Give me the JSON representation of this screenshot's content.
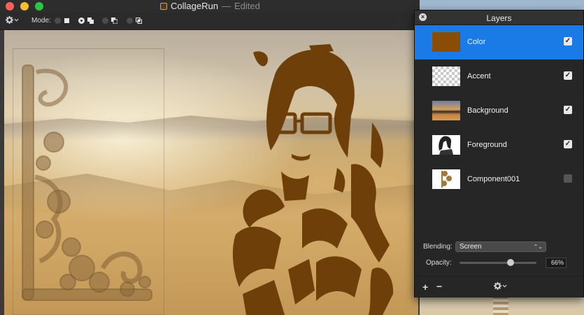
{
  "app": {
    "title": "CollageRun",
    "title_separator": "—",
    "status": "Edited"
  },
  "toolbar": {
    "gear_icon": "gear-icon",
    "mode_label": "Mode:",
    "modes": [
      {
        "icon": "mode-square-icon",
        "selected": false
      },
      {
        "icon": "mode-overlap-icon",
        "selected": true
      },
      {
        "icon": "mode-subtract-icon",
        "selected": false
      },
      {
        "icon": "mode-intersect-icon",
        "selected": false
      }
    ]
  },
  "layers_panel": {
    "title": "Layers",
    "layers": [
      {
        "name": "Color",
        "visible": true,
        "selected": true,
        "thumb": "color"
      },
      {
        "name": "Accent",
        "visible": true,
        "selected": false,
        "thumb": "checker"
      },
      {
        "name": "Background",
        "visible": true,
        "selected": false,
        "thumb": "desert-photo"
      },
      {
        "name": "Foreground",
        "visible": true,
        "selected": false,
        "thumb": "portrait-silhouette"
      },
      {
        "name": "Component001",
        "visible": false,
        "selected": false,
        "thumb": "ornament"
      }
    ],
    "blending_label": "Blending:",
    "blending_value": "Screen",
    "opacity_label": "Opacity:",
    "opacity_value": "66%",
    "opacity_fraction": 0.66,
    "add_label": "+",
    "remove_label": "−"
  },
  "colors": {
    "selection_blue": "#1a7ae6",
    "layer_color": "#8b4d05",
    "silhouette": "#6e3f08"
  }
}
